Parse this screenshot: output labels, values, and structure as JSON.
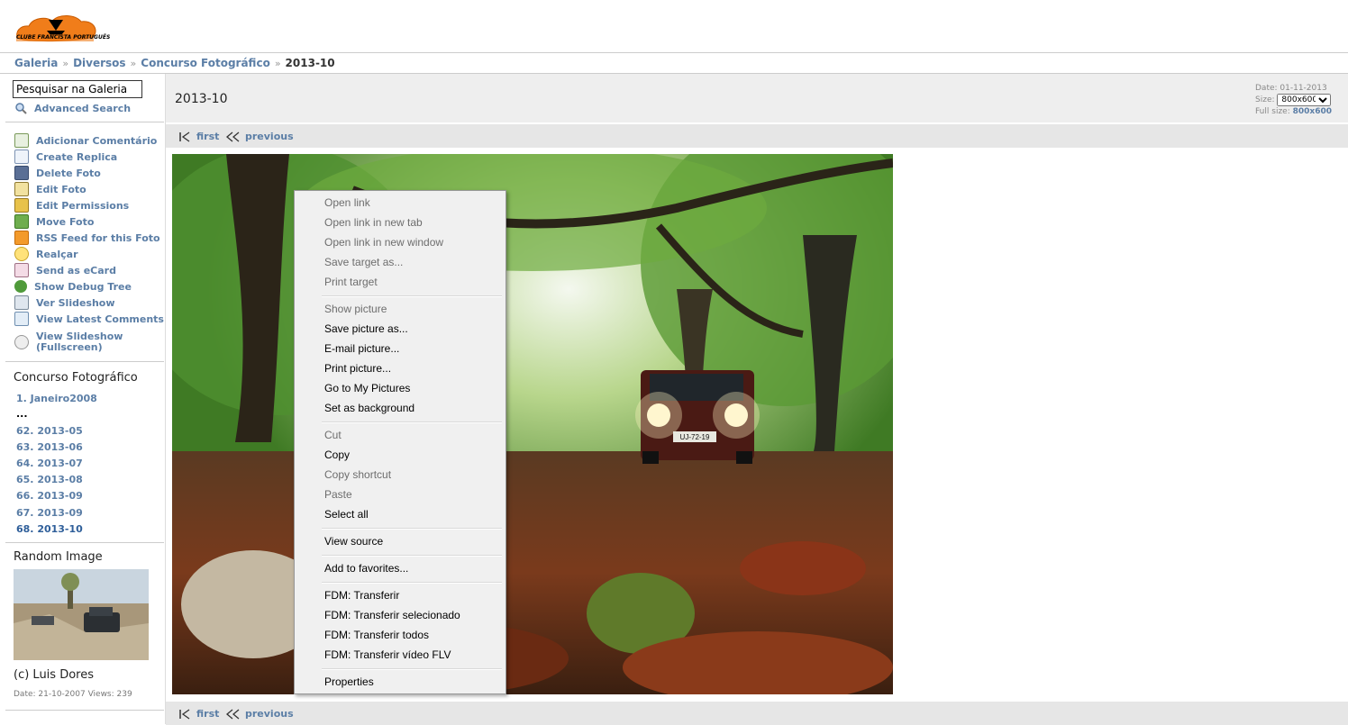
{
  "logo_text": "CLUBE FRANCISTA PORTUGUÊS",
  "breadcrumb": {
    "items": [
      "Galeria",
      "Diversos",
      "Concurso Fotográfico"
    ],
    "current": "2013-10",
    "separator": "»"
  },
  "sidebar": {
    "search_value": "Pesquisar na Galeria",
    "advanced_search": "Advanced Search",
    "actions": [
      "Adicionar Comentário",
      "Create Replica",
      "Delete Foto",
      "Edit Foto",
      "Edit Permissions",
      "Move Foto",
      "RSS Feed for this Foto",
      "Realçar",
      "Send as eCard",
      "Show Debug Tree",
      "Ver Slideshow",
      "View Latest Comments",
      "View Slideshow",
      "(Fullscreen)"
    ],
    "album_title": "Concurso Fotográfico",
    "album_items": [
      "1. Janeiro2008",
      "...",
      "62. 2013-05",
      "63. 2013-06",
      "64. 2013-07",
      "65. 2013-08",
      "66. 2013-09",
      "67. 2013-09",
      "68. 2013-10"
    ],
    "random_title": "Random Image",
    "credit": "(c) Luis Dores",
    "meta": "Date: 21-10-2007 Views: 239"
  },
  "photo": {
    "title": "2013-10",
    "date": "Date: 01-11-2013",
    "size_label": "Size:",
    "size_value": "800x600",
    "full_size_label": "Full size:",
    "full_size_value": "800x600",
    "plate": "UJ-72-19"
  },
  "nav": {
    "first": "first",
    "previous": "previous"
  },
  "context_menu": {
    "items": [
      "Open link",
      "Open link in new tab",
      "Open link in new window",
      "Save target as...",
      "Print target",
      "Show picture",
      "Save picture as...",
      "E-mail picture...",
      "Print picture...",
      "Go to My Pictures",
      "Set as background",
      "Cut",
      "Copy",
      "Copy shortcut",
      "Paste",
      "Select all",
      "View source",
      "Add to favorites...",
      "FDM: Transferir",
      "FDM: Transferir selecionado",
      "FDM: Transferir todos",
      "FDM: Transferir vídeo FLV",
      "Properties"
    ]
  },
  "colors": {
    "link": "#5b7ea6",
    "nav_bg": "#e6e6e6",
    "title_bg": "#eeeeee",
    "logo_orange": "#f07d1a"
  }
}
